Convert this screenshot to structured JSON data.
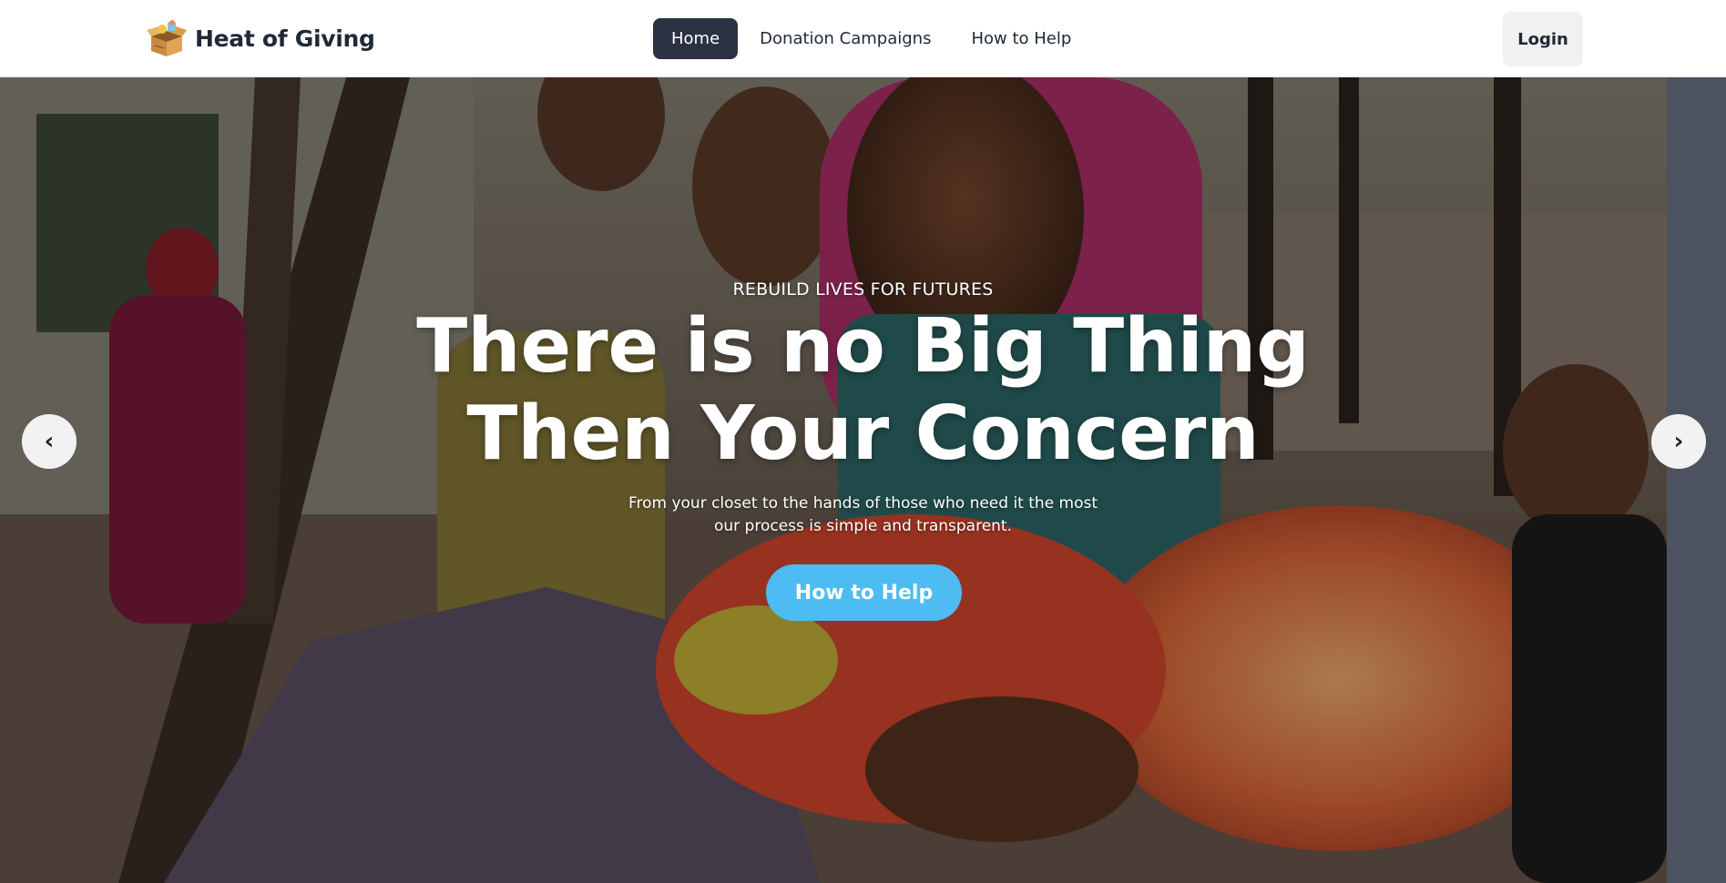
{
  "brand": {
    "name": "Heat of Giving",
    "logo_icon": "donation-box-icon"
  },
  "nav": {
    "items": [
      {
        "label": "Home",
        "active": true
      },
      {
        "label": "Donation Campaigns",
        "active": false
      },
      {
        "label": "How to Help",
        "active": false
      }
    ],
    "login_label": "Login"
  },
  "hero": {
    "eyebrow": "REBUILD LIVES FOR FUTURES",
    "headline_line1": "There is no Big Thing",
    "headline_line2": "Then Your Concern",
    "subtext_line1": "From your closet to the hands of those who need it the most",
    "subtext_line2": "our process is simple and transparent.",
    "cta_label": "How to Help",
    "prev_symbol": "‹",
    "next_symbol": "›"
  },
  "colors": {
    "nav_active_bg": "#2b3242",
    "cta_bg": "#4cbcf3",
    "text_dark": "#1f2937",
    "login_bg": "#f1f1f1"
  }
}
